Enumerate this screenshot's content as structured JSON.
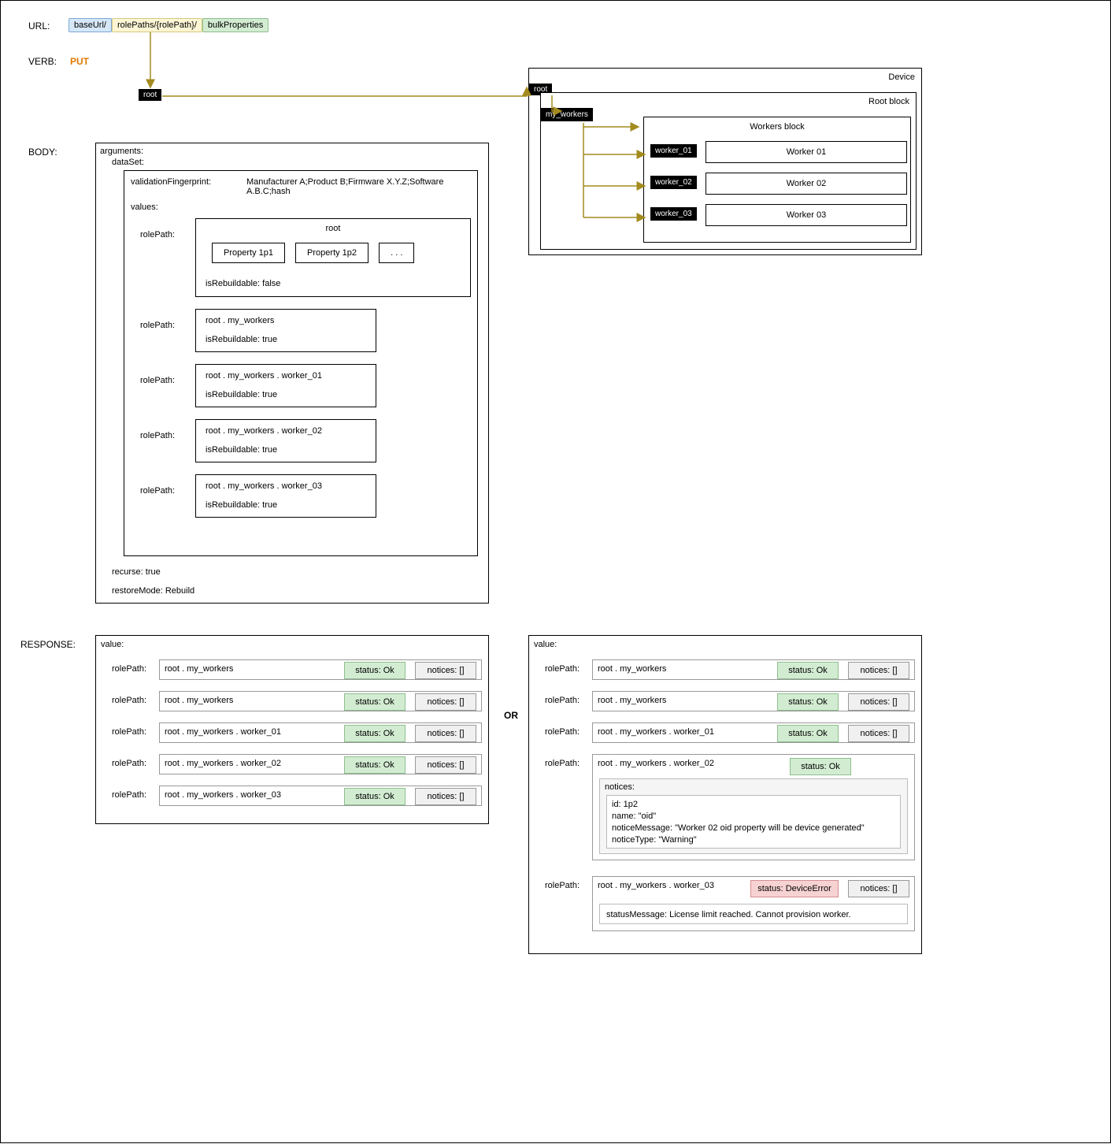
{
  "labels": {
    "url": "URL:",
    "verb": "VERB:",
    "body": "BODY:",
    "response": "RESPONSE:",
    "or": "OR"
  },
  "url": {
    "base": "baseUrl/",
    "role": "rolePaths/{rolePath}/",
    "bulk": "bulkProperties"
  },
  "verb": "PUT",
  "device": {
    "title": "Device",
    "root": "root",
    "rootBlock": "Root block",
    "myWorkers": "my_workers",
    "workersBlock": "Workers block",
    "workers": [
      {
        "key": "worker_01",
        "title": "Worker 01"
      },
      {
        "key": "worker_02",
        "title": "Worker 02"
      },
      {
        "key": "worker_03",
        "title": "Worker 03"
      }
    ]
  },
  "body": {
    "argsLabel": "arguments:",
    "dataSetLabel": "dataSet:",
    "vfLabel": "validationFingerprint:",
    "vfValue": "Manufacturer A;Product B;Firmware X.Y.Z;Software A.B.C;hash",
    "valuesLabel": "values:",
    "rolePathLabel": "rolePath:",
    "rootTitle": "root",
    "props": [
      "Property 1p1",
      "Property 1p2",
      ". . ."
    ],
    "isRebuildFalse": "isRebuildable: false",
    "isRebuildTrue": "isRebuildable: true",
    "paths": {
      "p1": "root . my_workers",
      "p2": "root . my_workers . worker_01",
      "p3": "root . my_workers . worker_02",
      "p4": "root . my_workers . worker_03"
    },
    "recurse": "recurse: true",
    "restore": "restoreMode: Rebuild"
  },
  "resp": {
    "valueLabel": "value:",
    "rolePathLabel": "rolePath:",
    "statusOk": "status: Ok",
    "notices": "notices: []",
    "statusErr": "status: DeviceError",
    "left": [
      "root . my_workers",
      "root . my_workers",
      "root . my_workers . worker_01",
      "root . my_workers . worker_02",
      "root . my_workers . worker_03"
    ],
    "right": {
      "rows": [
        "root . my_workers",
        "root . my_workers",
        "root . my_workers . worker_01"
      ],
      "w2": {
        "path": "root . my_workers . worker_02",
        "noticesLabel": "notices:",
        "lines": [
          "id: 1p2",
          "name: \"oid\"",
          "noticeMessage: \"Worker 02 oid property will be device generated\"",
          "noticeType: \"Warning\""
        ]
      },
      "w3": {
        "path": "root . my_workers . worker_03",
        "statusMsg": "statusMessage: License limit reached. Cannot provision worker."
      }
    }
  }
}
